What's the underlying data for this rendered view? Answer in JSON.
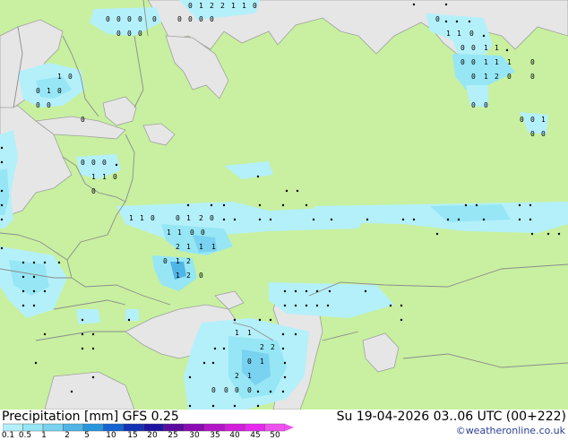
{
  "map": {
    "colors": {
      "land": "#c8f0a0",
      "sea": "#e6e6e6",
      "border": "#8c8c8c",
      "coast": "#a0a0a0"
    },
    "value_labels": [
      "0",
      "0",
      "0",
      "0",
      "0",
      "0",
      "0",
      "0",
      "0",
      "0",
      "1",
      "2",
      "2",
      "1",
      "1",
      "0",
      "0",
      "0",
      "0",
      "0",
      "1",
      "1",
      "0",
      "0",
      "0",
      "1",
      "1",
      "0",
      "0",
      "1",
      "1",
      "1",
      "0",
      "0",
      "1",
      "2",
      "0",
      "0",
      "0",
      "0",
      "0",
      "0",
      "1",
      "0",
      "0",
      "1",
      "0",
      "0",
      "1",
      "0",
      "0",
      "0",
      "0",
      "0",
      "0",
      "0",
      "1",
      "1",
      "0",
      "0",
      "1",
      "1",
      "0",
      "0",
      "1",
      "2",
      "0",
      "1",
      "1",
      "0",
      "0",
      "2",
      "1",
      "1",
      "1",
      "0",
      "1",
      "2",
      "1",
      "2",
      "0",
      "1",
      "1",
      "2",
      "2",
      "0",
      "1",
      "2",
      "1",
      "0",
      "0",
      "0",
      "0",
      "0"
    ]
  },
  "footer": {
    "title": "Precipitation [mm]  GFS 0.25",
    "datetime": "Su 19-04-2026 03..06 UTC (00+222)",
    "credit": "©weatheronline.co.uk",
    "scale": {
      "labels": [
        "0.1",
        "0.5",
        "1",
        "2",
        "5",
        "10",
        "15",
        "20",
        "25",
        "30",
        "35",
        "40",
        "45",
        "50"
      ],
      "colors": [
        "#b4f0fa",
        "#96e6f5",
        "#78d2f0",
        "#50b4e6",
        "#2896dc",
        "#1464d2",
        "#1432b4",
        "#1e14a0",
        "#5a0aa0",
        "#8c0ab4",
        "#b414c8",
        "#d21edc",
        "#e628f0",
        "#f050f0"
      ]
    }
  }
}
